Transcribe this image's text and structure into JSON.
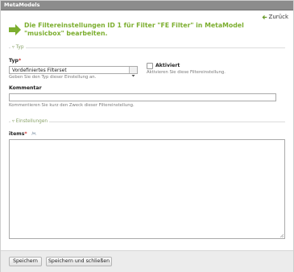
{
  "window": {
    "title": "MetaModels"
  },
  "nav": {
    "back_label": "Zurück"
  },
  "headline": {
    "text": "Die Filtereinstellungen ID 1 für Filter \"FE Filter\" in MetaModel \"musicbox\" bearbeiten."
  },
  "sections": {
    "typ": "Typ",
    "einstellungen": "Einstellungen"
  },
  "form": {
    "typ": {
      "label": "Typ",
      "required_mark": "*",
      "selected_value": "Vordefiniertes Filterset",
      "help": "Geben Sie den Typ dieser Einstellung an."
    },
    "aktiviert": {
      "label": "Aktiviert",
      "checked": false,
      "help": "Aktivieren Sie diese Filtereinstellung."
    },
    "kommentar": {
      "label": "Kommentar",
      "value": "",
      "help": "Kommentieren Sie kurz den Zweck dieser Filtereinstellung."
    },
    "items": {
      "label": "items",
      "required_mark": "*",
      "value": ""
    }
  },
  "buttons": {
    "save": "Speichern",
    "save_close": "Speichern und schließen"
  },
  "colors": {
    "accent_green": "#7cae2f",
    "titlebar": "#8c8c8c",
    "required": "#cc3333"
  }
}
